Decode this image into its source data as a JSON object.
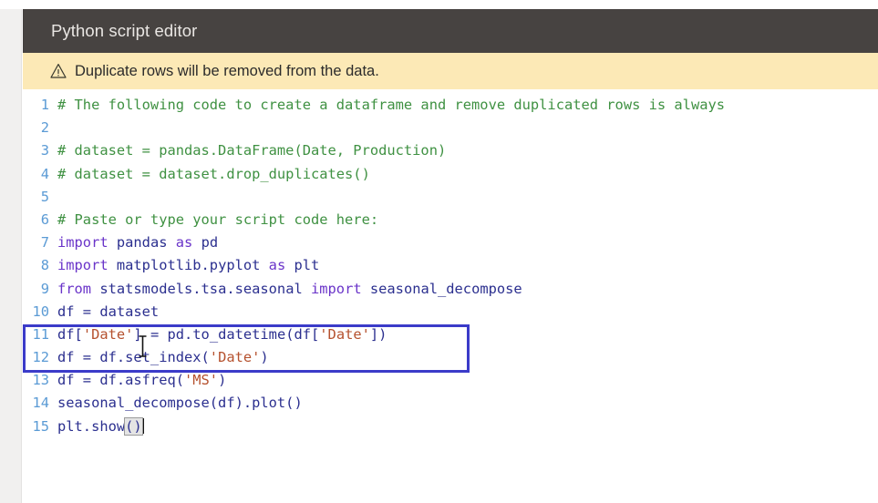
{
  "header": {
    "title": "Python script editor"
  },
  "warning": {
    "icon": "warning-triangle-icon",
    "text": "Duplicate rows will be removed from the data."
  },
  "editor": {
    "language": "python",
    "caret_line": 15,
    "highlighted_lines": [
      11,
      12
    ],
    "colors": {
      "header_bg": "#474341",
      "header_text": "#e9e6e3",
      "warning_bg": "#fce9b6",
      "warning_text": "#2b2b2b",
      "editor_bg": "#ffffff",
      "line_number": "#5b9bd5",
      "comment": "#3f9142",
      "keyword": "#6a34c9",
      "string": "#b5512e",
      "identifier": "#2b2f8f",
      "focus_box_border": "#3b3bc9",
      "bracket_match_bg": "#e4e4e4",
      "page_margin": "#f1f0ef"
    },
    "lines": [
      {
        "n": "1",
        "text": "# The following code to create a dataframe and remove duplicated rows is always",
        "tokens": [
          {
            "t": "# The following code to create a dataframe and remove duplicated rows is always",
            "c": "tok-comment"
          }
        ]
      },
      {
        "n": "2",
        "text": "",
        "tokens": []
      },
      {
        "n": "3",
        "text": "# dataset = pandas.DataFrame(Date, Production)",
        "tokens": [
          {
            "t": "# dataset = pandas.DataFrame(Date, Production)",
            "c": "tok-comment"
          }
        ]
      },
      {
        "n": "4",
        "text": "# dataset = dataset.drop_duplicates()",
        "tokens": [
          {
            "t": "# dataset = dataset.drop_duplicates()",
            "c": "tok-comment"
          }
        ]
      },
      {
        "n": "5",
        "text": "",
        "tokens": []
      },
      {
        "n": "6",
        "text": "# Paste or type your script code here:",
        "tokens": [
          {
            "t": "# Paste or type your script code here:",
            "c": "tok-comment"
          }
        ]
      },
      {
        "n": "7",
        "text": "import pandas as pd",
        "tokens": [
          {
            "t": "import",
            "c": "tok-kw"
          },
          {
            "t": " pandas ",
            "c": "tok-plain"
          },
          {
            "t": "as",
            "c": "tok-kw"
          },
          {
            "t": " pd",
            "c": "tok-plain"
          }
        ]
      },
      {
        "n": "8",
        "text": "import matplotlib.pyplot as plt",
        "tokens": [
          {
            "t": "import",
            "c": "tok-kw"
          },
          {
            "t": " matplotlib.pyplot ",
            "c": "tok-plain"
          },
          {
            "t": "as",
            "c": "tok-kw"
          },
          {
            "t": " plt",
            "c": "tok-plain"
          }
        ]
      },
      {
        "n": "9",
        "text": "from statsmodels.tsa.seasonal import seasonal_decompose",
        "tokens": [
          {
            "t": "from",
            "c": "tok-kw"
          },
          {
            "t": " statsmodels.tsa.seasonal ",
            "c": "tok-plain"
          },
          {
            "t": "import",
            "c": "tok-kw"
          },
          {
            "t": " seasonal_decompose",
            "c": "tok-plain"
          }
        ]
      },
      {
        "n": "10",
        "text": "df = dataset",
        "tokens": [
          {
            "t": "df = dataset",
            "c": "tok-plain"
          }
        ]
      },
      {
        "n": "11",
        "text": "df['Date'] = pd.to_datetime(df['Date'])",
        "tokens": [
          {
            "t": "df[",
            "c": "tok-plain"
          },
          {
            "t": "'Date'",
            "c": "tok-str"
          },
          {
            "t": "] = pd.to_datetime(df[",
            "c": "tok-plain"
          },
          {
            "t": "'Date'",
            "c": "tok-str"
          },
          {
            "t": "])",
            "c": "tok-plain"
          }
        ]
      },
      {
        "n": "12",
        "text": "df = df.set_index('Date')",
        "tokens": [
          {
            "t": "df = df.set_index(",
            "c": "tok-plain"
          },
          {
            "t": "'Date'",
            "c": "tok-str"
          },
          {
            "t": ")",
            "c": "tok-plain"
          }
        ]
      },
      {
        "n": "13",
        "text": "df = df.asfreq('MS')",
        "tokens": [
          {
            "t": "df = df.asfreq(",
            "c": "tok-plain"
          },
          {
            "t": "'MS'",
            "c": "tok-str"
          },
          {
            "t": ")",
            "c": "tok-plain"
          }
        ]
      },
      {
        "n": "14",
        "text": "seasonal_decompose(df).plot()",
        "tokens": [
          {
            "t": "seasonal_decompose(df).plot()",
            "c": "tok-plain"
          }
        ]
      },
      {
        "n": "15",
        "text": "plt.show()",
        "tokens": [
          {
            "t": "plt.show",
            "c": "tok-plain"
          },
          {
            "t": "()",
            "c": "tok-plain",
            "hl": true
          },
          {
            "t": "",
            "c": "tok-plain",
            "caret": true
          }
        ]
      }
    ]
  }
}
